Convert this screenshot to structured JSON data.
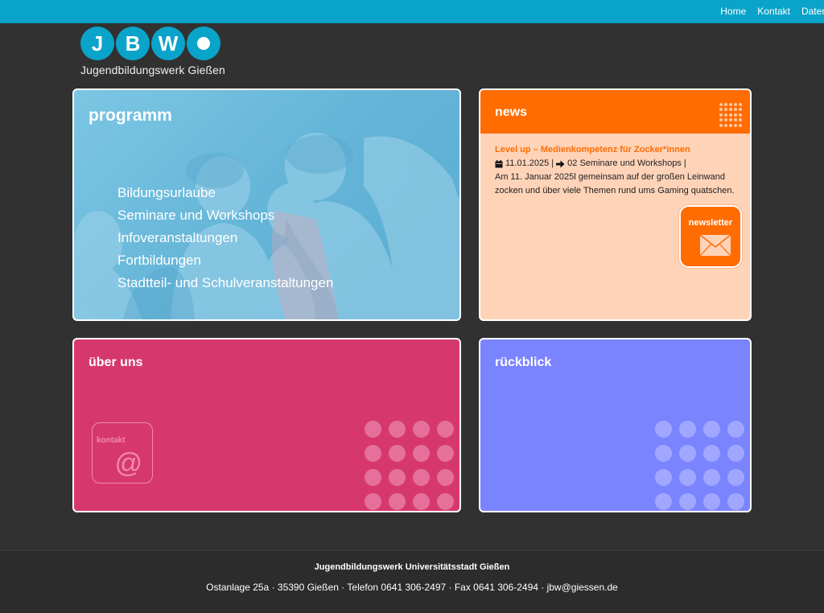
{
  "nav": {
    "items": [
      "Home",
      "Kontakt",
      "Datens"
    ]
  },
  "logo": {
    "letters": [
      "J",
      "B",
      "W"
    ],
    "subtitle": "Jugendbildungswerk Gießen"
  },
  "programm": {
    "title": "programm",
    "items": [
      "Bildungsurlaube",
      "Seminare und Workshops",
      "Infoveranstaltungen",
      "Fortbildungen",
      "Stadtteil- und Schulveranstaltungen"
    ]
  },
  "news": {
    "title": "news",
    "article_title": "Level up – Medienkompetenz für Zocker*innen",
    "date": "11.01.2025 |",
    "category": "02 Seminare und Workshops |",
    "text": "Am 11. Januar 2025l gemeinsam auf der großen Leinwand zocken und über viele Themen rund ums Gaming quatschen.",
    "newsletter_label": "newsletter"
  },
  "ueber": {
    "title": "über uns",
    "kontakt_label": "kontakt",
    "kontakt_symbol": "@"
  },
  "rueckblick": {
    "title": "rückblick"
  },
  "footer": {
    "title": "Jugendbildungswerk Universitätsstadt Gießen",
    "address": "Ostanlage 25a · 35390 Gießen · Telefon 0641 306-2497 · Fax 0641 306-2494 · jbw@giessen.de"
  },
  "colors": {
    "brand_blue": "#0aa3c9",
    "news_orange": "#ff6c02",
    "ueber_pink": "#d6386e",
    "rueck_violet": "#7b84ff"
  }
}
